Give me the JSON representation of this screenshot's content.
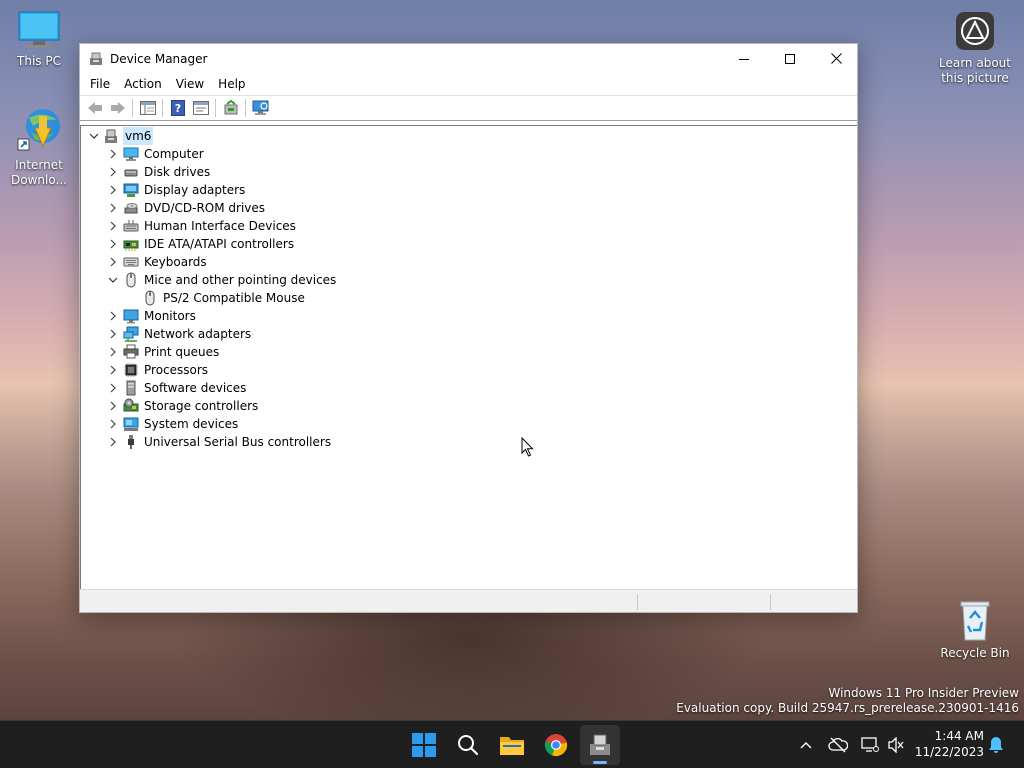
{
  "desktop": {
    "icons": [
      {
        "label": "This PC"
      },
      {
        "label": "Internet\nDownlo..."
      },
      {
        "label": "Learn about\nthis picture"
      },
      {
        "label": "Recycle Bin"
      }
    ],
    "watermark": {
      "line1": "Windows 11 Pro Insider Preview",
      "line2": "Evaluation copy. Build 25947.rs_prerelease.230901-1416"
    }
  },
  "window": {
    "title": "Device Manager",
    "menu": [
      "File",
      "Action",
      "View",
      "Help"
    ],
    "tree": {
      "root": "vm6",
      "categories": [
        {
          "label": "Computer",
          "icon": "computer-icon"
        },
        {
          "label": "Disk drives",
          "icon": "disk-drive-icon"
        },
        {
          "label": "Display adapters",
          "icon": "display-adapter-icon"
        },
        {
          "label": "DVD/CD-ROM drives",
          "icon": "dvd-drive-icon"
        },
        {
          "label": "Human Interface Devices",
          "icon": "hid-icon"
        },
        {
          "label": "IDE ATA/ATAPI controllers",
          "icon": "ide-controller-icon"
        },
        {
          "label": "Keyboards",
          "icon": "keyboard-icon"
        },
        {
          "label": "Mice and other pointing devices",
          "icon": "mouse-icon",
          "expanded": true,
          "children": [
            {
              "label": "PS/2 Compatible Mouse",
              "icon": "mouse-icon"
            }
          ]
        },
        {
          "label": "Monitors",
          "icon": "monitor-icon"
        },
        {
          "label": "Network adapters",
          "icon": "network-adapter-icon"
        },
        {
          "label": "Print queues",
          "icon": "printer-icon"
        },
        {
          "label": "Processors",
          "icon": "processor-icon"
        },
        {
          "label": "Software devices",
          "icon": "software-device-icon"
        },
        {
          "label": "Storage controllers",
          "icon": "storage-controller-icon"
        },
        {
          "label": "System devices",
          "icon": "system-device-icon"
        },
        {
          "label": "Universal Serial Bus controllers",
          "icon": "usb-icon"
        }
      ]
    }
  },
  "taskbar": {
    "clock": {
      "time": "1:44 AM",
      "date": "11/22/2023"
    }
  },
  "colors": {
    "selection": "#cce8ff",
    "taskbar": "#1f1f1f",
    "accent": "#0078d4"
  }
}
